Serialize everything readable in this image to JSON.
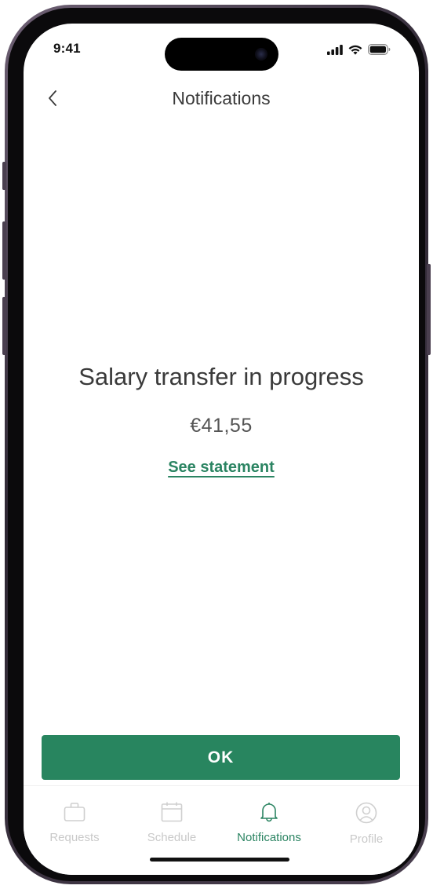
{
  "status_bar": {
    "time": "9:41",
    "icons": [
      "cellular-signal-icon",
      "wifi-icon",
      "battery-icon"
    ]
  },
  "nav": {
    "title": "Notifications",
    "back_icon": "chevron-left-icon"
  },
  "content": {
    "headline": "Salary transfer in progress",
    "amount": "€41,55",
    "link_label": "See statement"
  },
  "actions": {
    "ok_label": "OK"
  },
  "tabbar": {
    "items": [
      {
        "label": "Requests",
        "icon": "briefcase-icon",
        "active": false
      },
      {
        "label": "Schedule",
        "icon": "calendar-icon",
        "active": false
      },
      {
        "label": "Notifications",
        "icon": "bell-icon",
        "active": true
      },
      {
        "label": "Profile",
        "icon": "profile-icon",
        "active": false
      }
    ]
  },
  "colors": {
    "accent": "#28855f",
    "text": "#3a3a3a",
    "inactive": "#c9c9c9"
  }
}
